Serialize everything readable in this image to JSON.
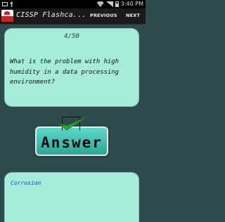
{
  "status_bar": {
    "time": "3:40 PM",
    "icons": [
      "mail-icon",
      "usb-icon",
      "wifi-icon",
      "signal-icon",
      "battery-icon"
    ]
  },
  "app_bar": {
    "title": "CISSP Flashca...",
    "prev_label": "PREVIOUS",
    "next_label": "NEXT"
  },
  "question_card": {
    "counter": "4/50",
    "question": "What is the problem with high humidity in a data processing environment?"
  },
  "answer_button": {
    "label": "Answer",
    "icon": "checkbox-check-icon"
  },
  "answer_card": {
    "answer": "Corrosion"
  },
  "colors": {
    "background": "#2f4a4d",
    "card": "#a5ecd9",
    "answer_text": "#1d3dc8",
    "check": "#2ea82e"
  }
}
